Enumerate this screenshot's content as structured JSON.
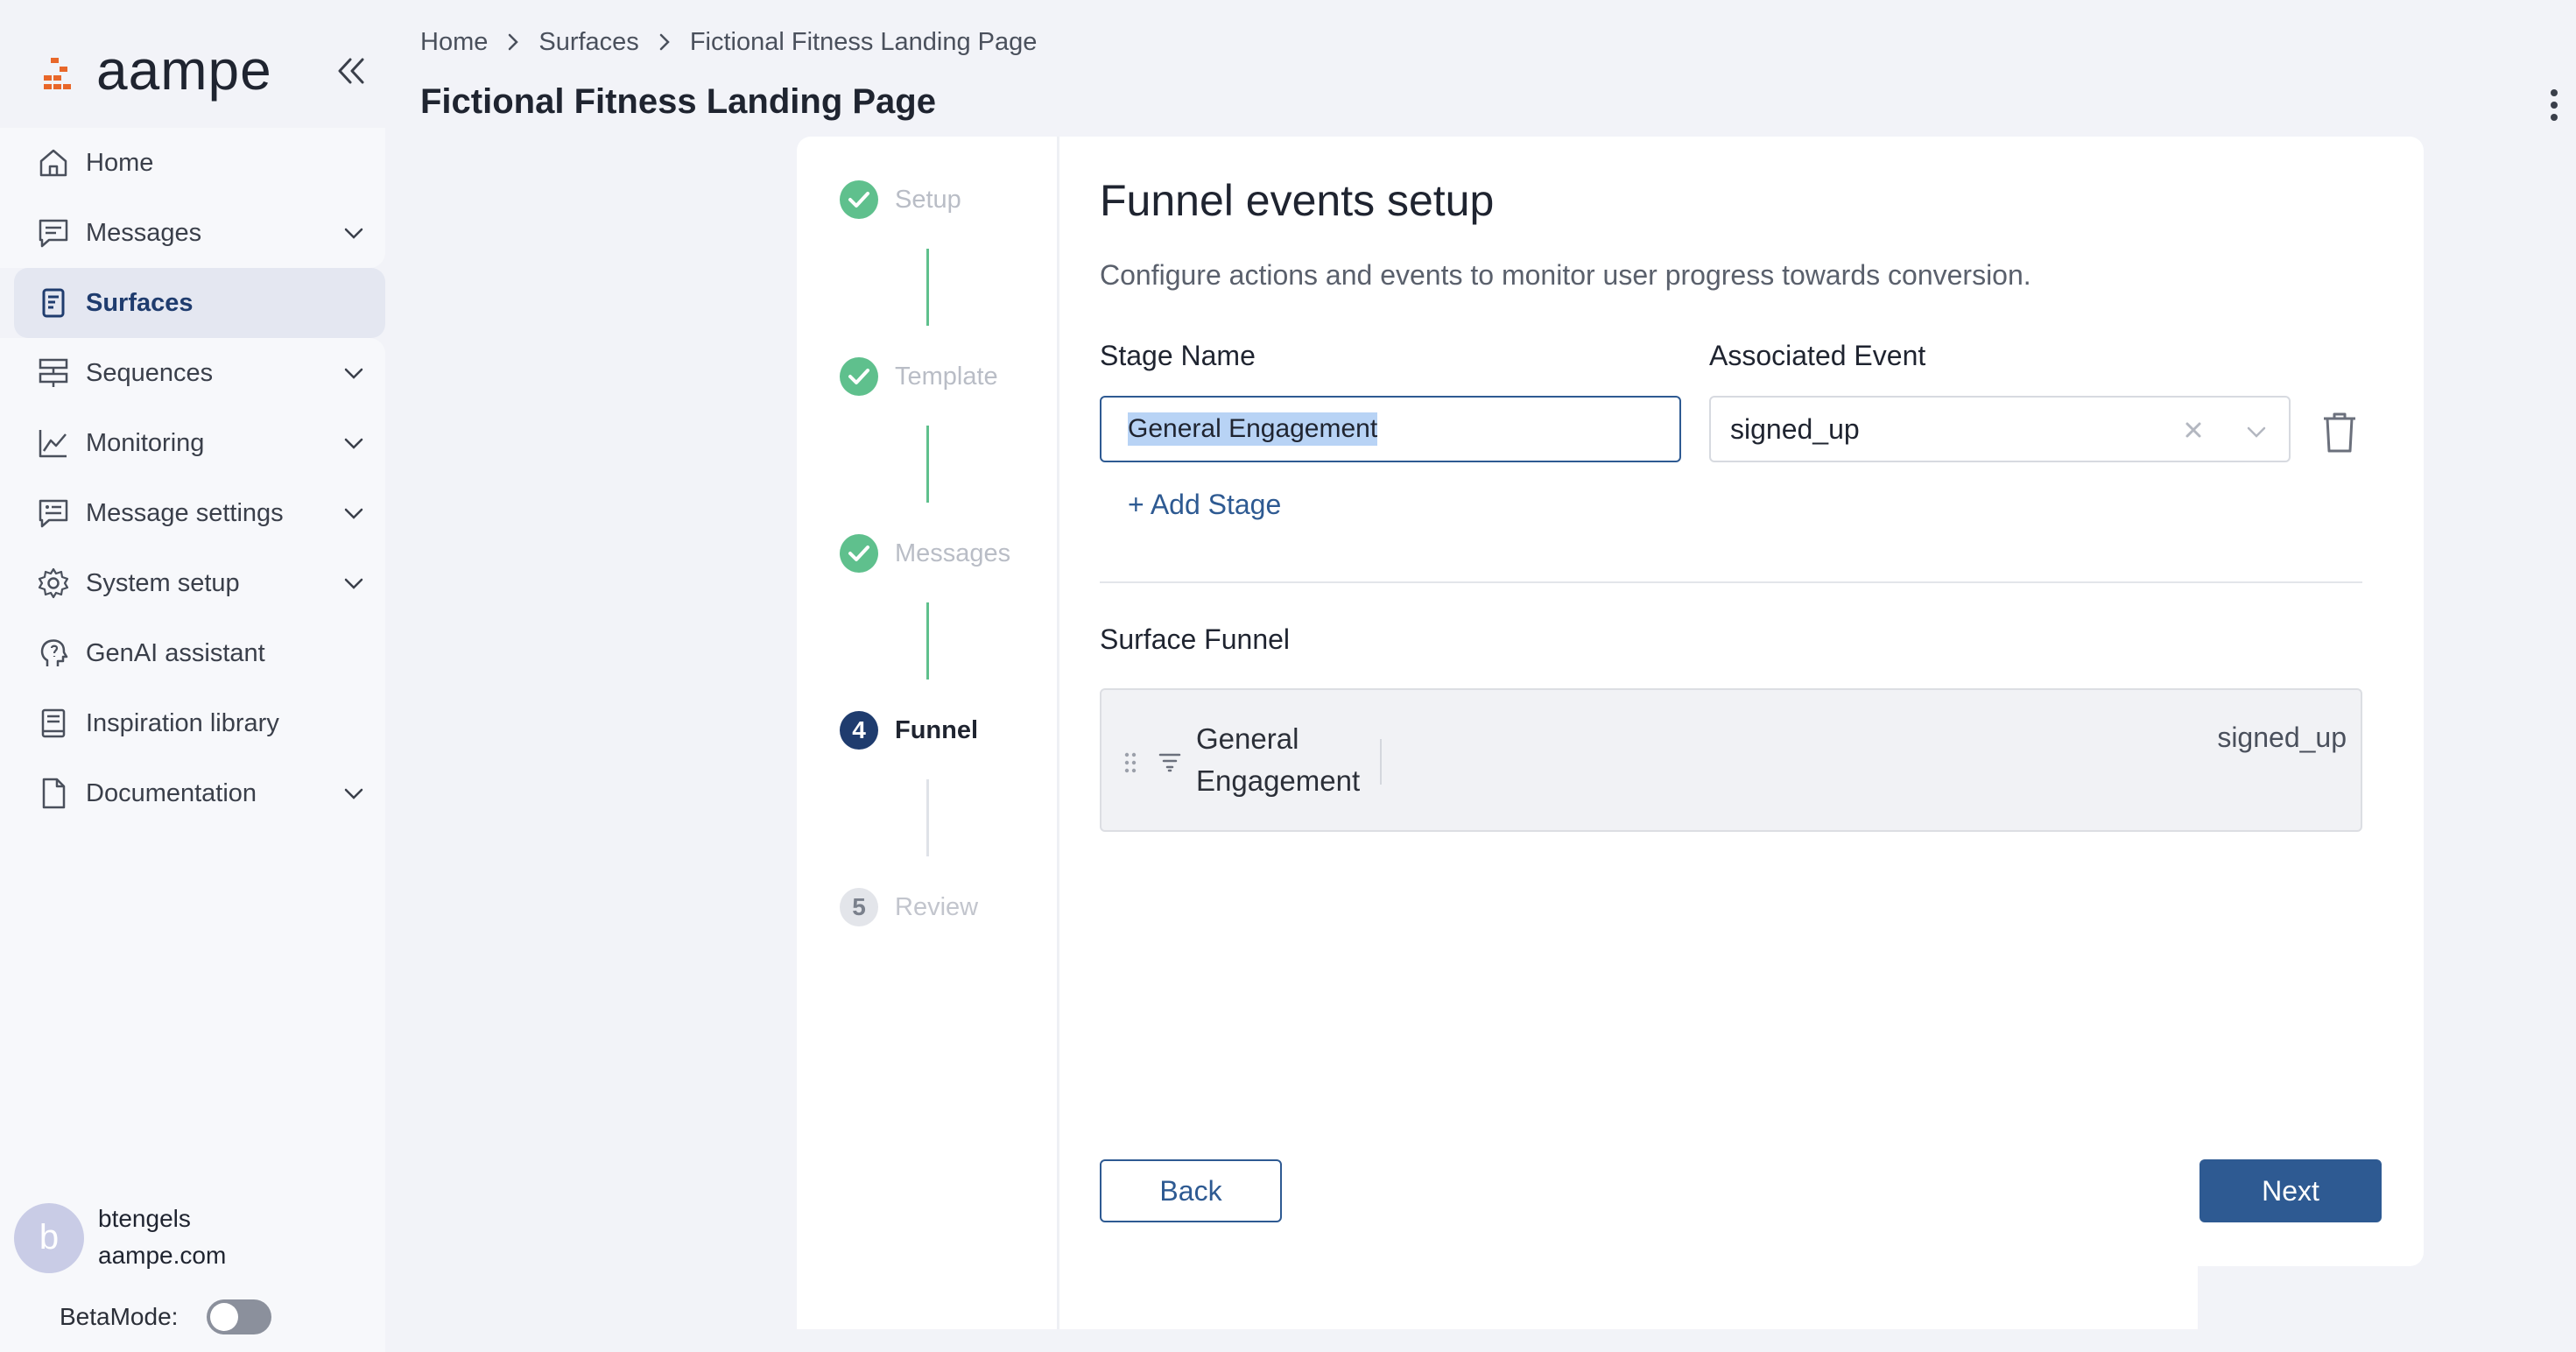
{
  "app": {
    "logo_text": "aampe",
    "brand_color": "#e8672a",
    "accent_color": "#2e5a92"
  },
  "sidebar": {
    "items": [
      {
        "label": "Home",
        "icon": "home-icon",
        "has_chevron": false,
        "active": false
      },
      {
        "label": "Messages",
        "icon": "messages-icon",
        "has_chevron": true,
        "active": false
      },
      {
        "label": "Surfaces",
        "icon": "surfaces-icon",
        "has_chevron": false,
        "active": true
      },
      {
        "label": "Sequences",
        "icon": "sequences-icon",
        "has_chevron": true,
        "active": false
      },
      {
        "label": "Monitoring",
        "icon": "monitoring-icon",
        "has_chevron": true,
        "active": false
      },
      {
        "label": "Message settings",
        "icon": "message-settings-icon",
        "has_chevron": true,
        "active": false
      },
      {
        "label": "System setup",
        "icon": "gear-icon",
        "has_chevron": true,
        "active": false
      },
      {
        "label": "GenAI assistant",
        "icon": "genai-icon",
        "has_chevron": false,
        "active": false
      },
      {
        "label": "Inspiration library",
        "icon": "book-icon",
        "has_chevron": false,
        "active": false
      },
      {
        "label": "Documentation",
        "icon": "document-icon",
        "has_chevron": true,
        "active": false
      }
    ],
    "user": {
      "avatar_initial": "b",
      "name": "btengels",
      "domain": "aampe.com"
    },
    "beta_label": "BetaMode:",
    "beta_enabled": false
  },
  "header": {
    "breadcrumb": [
      "Home",
      "Surfaces",
      "Fictional Fitness Landing Page"
    ],
    "title": "Fictional Fitness Landing Page"
  },
  "stepper": {
    "steps": [
      {
        "label": "Setup",
        "state": "done"
      },
      {
        "label": "Template",
        "state": "done"
      },
      {
        "label": "Messages",
        "state": "done"
      },
      {
        "label": "Funnel",
        "state": "current",
        "number": "4"
      },
      {
        "label": "Review",
        "state": "todo",
        "number": "5"
      }
    ]
  },
  "funnel": {
    "title": "Funnel events setup",
    "description": "Configure actions and events to monitor user progress towards conversion.",
    "stage_name_label": "Stage Name",
    "associated_event_label": "Associated Event",
    "stage_name_value": "General Engagement",
    "associated_event_value": "signed_up",
    "add_stage_label": "+ Add Stage",
    "surface_funnel_title": "Surface Funnel",
    "funnel_rows": [
      {
        "stage": "General Engagement",
        "event": "signed_up"
      }
    ]
  },
  "footer": {
    "back_label": "Back",
    "next_label": "Next"
  }
}
